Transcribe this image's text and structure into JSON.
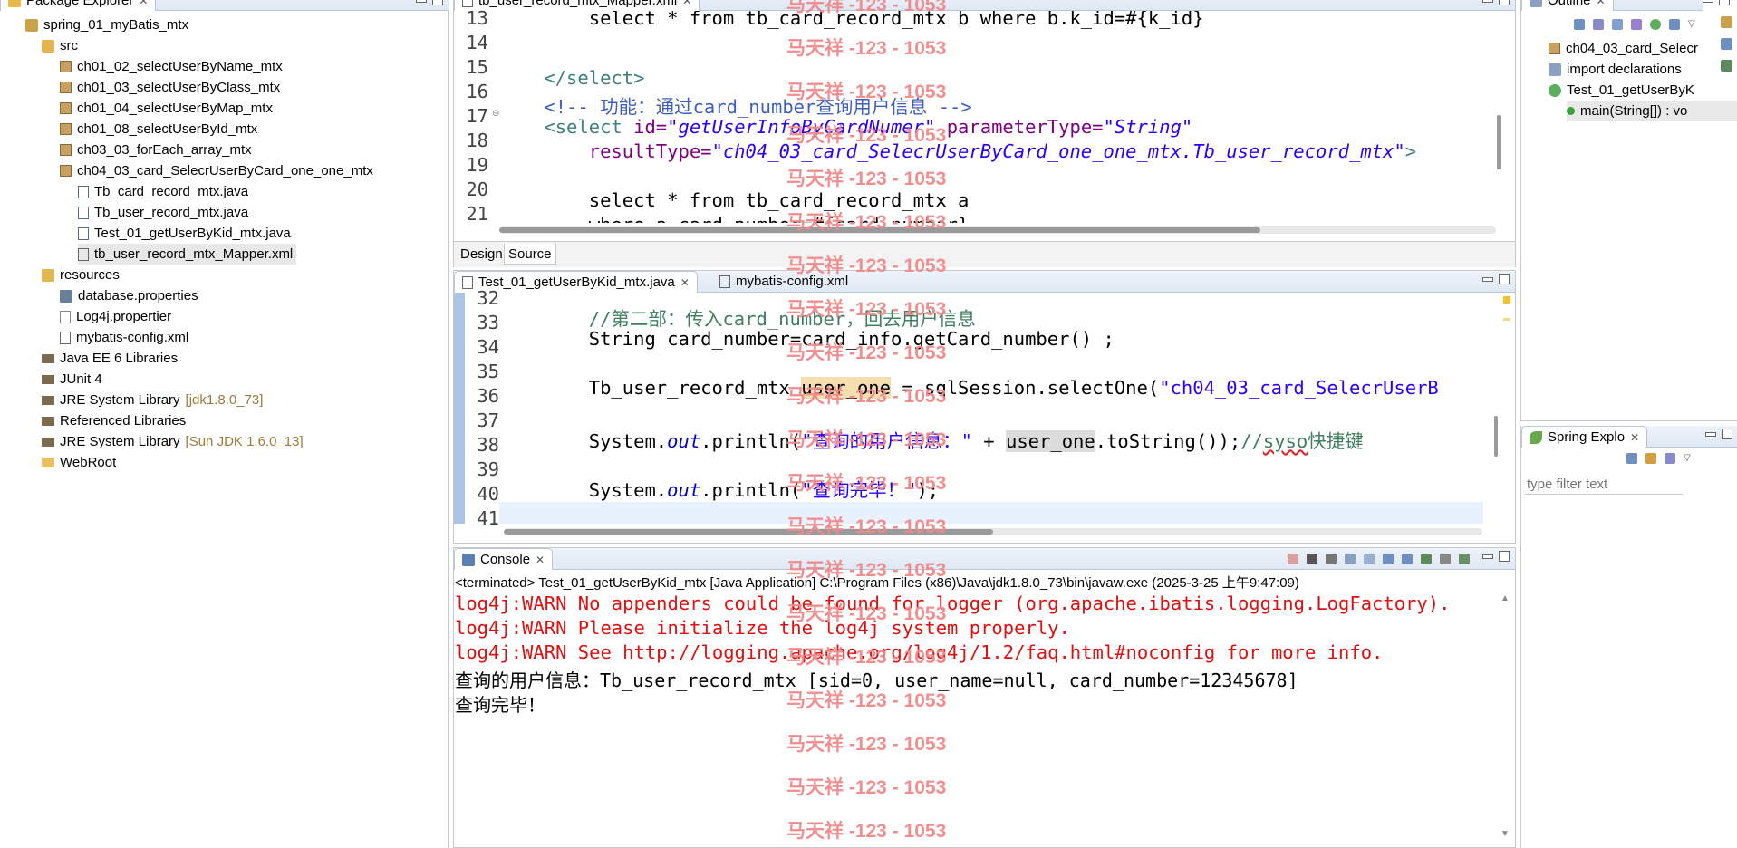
{
  "package_explorer": {
    "title": "Package Explorer",
    "items": [
      {
        "label": "spring_01_myBatis_mtx",
        "extra": "",
        "icon": "project-icon"
      },
      {
        "label": "src",
        "extra": "",
        "icon": "source-folder-icon"
      },
      {
        "label": "ch01_02_selectUserByName_mtx",
        "extra": "",
        "icon": "package-icon"
      },
      {
        "label": "ch01_03_selectUserByClass_mtx",
        "extra": "",
        "icon": "package-icon"
      },
      {
        "label": "ch01_04_selectUserByMap_mtx",
        "extra": "",
        "icon": "package-icon"
      },
      {
        "label": "ch01_08_selectUserById_mtx",
        "extra": "",
        "icon": "package-icon"
      },
      {
        "label": "ch03_03_forEach_array_mtx",
        "extra": "",
        "icon": "package-icon"
      },
      {
        "label": "ch04_03_card_SelecrUserByCard_one_one_mtx",
        "extra": "",
        "icon": "package-icon"
      },
      {
        "label": "Tb_card_record_mtx.java",
        "extra": "",
        "icon": "java-file-icon"
      },
      {
        "label": "Tb_user_record_mtx.java",
        "extra": "",
        "icon": "java-file-icon"
      },
      {
        "label": "Test_01_getUserByKid_mtx.java",
        "extra": "",
        "icon": "java-file-icon"
      },
      {
        "label": "tb_user_record_mtx_Mapper.xml",
        "extra": "",
        "icon": "xml-file-icon"
      },
      {
        "label": "resources",
        "extra": "",
        "icon": "source-folder-icon"
      },
      {
        "label": "database.properties",
        "extra": "",
        "icon": "properties-file-icon"
      },
      {
        "label": "Log4j.propertier",
        "extra": "",
        "icon": "text-file-icon"
      },
      {
        "label": "mybatis-config.xml",
        "extra": "",
        "icon": "xml-file-icon"
      },
      {
        "label": "Java EE 6 Libraries",
        "extra": "",
        "icon": "library-icon"
      },
      {
        "label": "JUnit 4",
        "extra": "",
        "icon": "library-icon"
      },
      {
        "label": "JRE System Library",
        "extra": "[jdk1.8.0_73]",
        "icon": "library-icon"
      },
      {
        "label": "Referenced Libraries",
        "extra": "",
        "icon": "library-icon"
      },
      {
        "label": "JRE System Library",
        "extra": "[Sun JDK 1.6.0_13]",
        "icon": "library-icon"
      },
      {
        "label": "WebRoot",
        "extra": "",
        "icon": "folder-icon"
      }
    ]
  },
  "xml_editor": {
    "tab_label": "tb_user_record_mtx_Mapper.xml",
    "line_numbers": [
      "13",
      "14",
      "15",
      "16",
      "17",
      "18",
      "19",
      "20",
      "21"
    ],
    "line13": "        select * from tb_card_record_mtx b where b.k_id=#{k_id}",
    "line15_close": "</select>",
    "line16_open": "<!-- 功能：通过",
    "line16_mid": "card_number",
    "line16_end": "查询用户信息 -->",
    "line17_tag": "<select",
    "line17_attr1": "id=",
    "line17_val1": "\"getUserInfoByCardNumer\"",
    "line17_attr2": "parameterType=",
    "line17_val2": "\"String\"",
    "line18_attr": "resultType=",
    "line18_val": "\"ch04_03_card_SelecrUserByCard_one_one_mtx.Tb_user_record_mtx\"",
    "line18_close": ">",
    "line20": "        select * from tb_card_record_mtx a",
    "line21": "        where a.card_number=#{card_number}",
    "design_tab": "Design",
    "source_tab": "Source"
  },
  "java_editor": {
    "tabs": [
      "Test_01_getUserByKid_mtx.java",
      "mybatis-config.xml"
    ],
    "line_numbers": [
      "32",
      "33",
      "34",
      "35",
      "36",
      "37",
      "38",
      "39",
      "40",
      "41"
    ],
    "line33_comment_a": "//第二部：传入",
    "line33_comment_b": "card_number",
    "line33_comment_c": "，回去用户信息",
    "line34": "        String card_number=card_info.getCard_number() ;",
    "line36_a": "        Tb_user_record_mtx ",
    "line36_var": "user_one",
    "line36_b": " = sqlSession.selectOne(",
    "line36_str": "\"ch04_03_card_SelecrUserB",
    "line38_a": "        System.",
    "line38_out": "out",
    "line38_b": ".println(",
    "line38_str": "\"查询的用户信息：\"",
    "line38_c": " + ",
    "line38_var": "user_one",
    "line38_d": ".toString());",
    "line38_cmt_a": "//",
    "line38_cmt_b": "syso",
    "line38_cmt_c": "快捷键",
    "line40_a": "        System.",
    "line40_out": "out",
    "line40_b": ".println(",
    "line40_str": "\"查询完毕！\"",
    "line40_c": ");"
  },
  "console": {
    "title": "Console",
    "status": "<terminated> Test_01_getUserByKid_mtx [Java Application] C:\\Program Files (x86)\\Java\\jdk1.8.0_73\\bin\\javaw.exe (2025-3-25 上午9:47:09)",
    "lines": [
      {
        "text": "log4j:WARN No appenders could be found for logger (org.apache.ibatis.logging.LogFactory).",
        "type": "err"
      },
      {
        "text": "log4j:WARN Please initialize the log4j system properly.",
        "type": "err"
      },
      {
        "text": "log4j:WARN See http://logging.apache.org/log4j/1.2/faq.html#noconfig for more info.",
        "type": "err"
      },
      {
        "text": "查询的用户信息：Tb_user_record_mtx [sid=0, user_name=null, card_number=12345678]",
        "type": "out"
      },
      {
        "text": "查询完毕！",
        "type": "out"
      }
    ]
  },
  "outline": {
    "title": "Outline",
    "items": [
      {
        "label": "ch04_03_card_Selecr",
        "icon": "package-icon"
      },
      {
        "label": "import declarations",
        "icon": "imports-icon"
      },
      {
        "label": "Test_01_getUserByK",
        "icon": "class-icon"
      },
      {
        "label": "main(String[]) : vo",
        "icon": "method-icon"
      }
    ]
  },
  "spring_explorer": {
    "title": "Spring Explo",
    "filter_placeholder": "type filter text"
  },
  "watermark": {
    "text": "马天祥 -123 - 1053",
    "count": 20
  },
  "colors": {
    "error_text": "#e01010",
    "watermark": "#f08a8a",
    "xml_tag": "#3f7f7f",
    "xml_attr": "#7f007f",
    "string": "#2a00ff"
  }
}
